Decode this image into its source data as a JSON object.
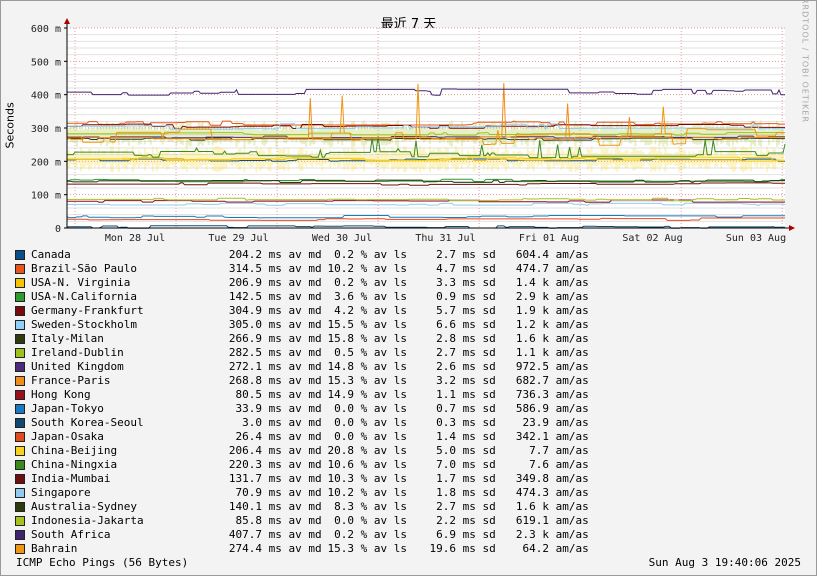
{
  "title": "最近 7 天",
  "watermark": "RRDTOOL / TOBI OETIKER",
  "footer": "ICMP Echo Pings (56 Bytes)",
  "timestamp": "Sun Aug  3 19:40:06 2025",
  "chart_data": {
    "type": "line",
    "ylabel": "Seconds",
    "ylim": [
      0,
      0.6
    ],
    "yticks": [
      {
        "v": 0,
        "label": "0"
      },
      {
        "v": 0.1,
        "label": "100 m"
      },
      {
        "v": 0.2,
        "label": "200 m"
      },
      {
        "v": 0.3,
        "label": "300 m"
      },
      {
        "v": 0.4,
        "label": "400 m"
      },
      {
        "v": 0.5,
        "label": "500 m"
      },
      {
        "v": 0.6,
        "label": "600 m"
      }
    ],
    "xticks": [
      "Mon 28 Jul",
      "Tue 29 Jul",
      "Wed 30 Jul",
      "Thu 31 Jul",
      "Fri 01 Aug",
      "Sat 02 Aug",
      "Sun 03 Aug"
    ],
    "grid": true,
    "legend_position": "bottom",
    "series": [
      {
        "name": "Canada",
        "color": "#0b4f8a",
        "avg": "204.2",
        "avg_unit": "ms av md",
        "loss": "0.2",
        "loss_unit": "% av ls",
        "sd": "2.7",
        "sd_unit": "ms sd",
        "am": "604.4",
        "am_unit": "am/as"
      },
      {
        "name": "Brazil-São Paulo",
        "color": "#e8541c",
        "avg": "314.5",
        "avg_unit": "ms av md",
        "loss": "10.2",
        "loss_unit": "% av ls",
        "sd": "4.7",
        "sd_unit": "ms sd",
        "am": "474.7",
        "am_unit": "am/as"
      },
      {
        "name": "USA-N. Virginia",
        "color": "#f4c400",
        "avg": "206.9",
        "avg_unit": "ms av md",
        "loss": "0.2",
        "loss_unit": "% av ls",
        "sd": "3.3",
        "sd_unit": "ms sd",
        "am": "1.4 k",
        "am_unit": "am/as"
      },
      {
        "name": "USA-N.California",
        "color": "#2f9a2f",
        "avg": "142.5",
        "avg_unit": "ms av md",
        "loss": "3.6",
        "loss_unit": "% av ls",
        "sd": "0.9",
        "sd_unit": "ms sd",
        "am": "2.9 k",
        "am_unit": "am/as"
      },
      {
        "name": "Germany-Frankfurt",
        "color": "#7a0a0a",
        "avg": "304.9",
        "avg_unit": "ms av md",
        "loss": "4.2",
        "loss_unit": "% av ls",
        "sd": "5.7",
        "sd_unit": "ms sd",
        "am": "1.9 k",
        "am_unit": "am/as"
      },
      {
        "name": "Sweden-Stockholm",
        "color": "#8fd0f5",
        "avg": "305.0",
        "avg_unit": "ms av md",
        "loss": "15.5",
        "loss_unit": "% av ls",
        "sd": "6.6",
        "sd_unit": "ms sd",
        "am": "1.2 k",
        "am_unit": "am/as"
      },
      {
        "name": "Italy-Milan",
        "color": "#2e3b10",
        "avg": "266.9",
        "avg_unit": "ms av md",
        "loss": "15.8",
        "loss_unit": "% av ls",
        "sd": "2.8",
        "sd_unit": "ms sd",
        "am": "1.6 k",
        "am_unit": "am/as"
      },
      {
        "name": "Ireland-Dublin",
        "color": "#9ec21c",
        "avg": "282.5",
        "avg_unit": "ms av md",
        "loss": "0.5",
        "loss_unit": "% av ls",
        "sd": "2.7",
        "sd_unit": "ms sd",
        "am": "1.1 k",
        "am_unit": "am/as"
      },
      {
        "name": "United Kingdom",
        "color": "#4b2a7a",
        "avg": "272.1",
        "avg_unit": "ms av md",
        "loss": "14.8",
        "loss_unit": "% av ls",
        "sd": "2.6",
        "sd_unit": "ms sd",
        "am": "972.5",
        "am_unit": "am/as"
      },
      {
        "name": "France-Paris",
        "color": "#f08c1a",
        "avg": "268.8",
        "avg_unit": "ms av md",
        "loss": "15.3",
        "loss_unit": "% av ls",
        "sd": "3.2",
        "sd_unit": "ms sd",
        "am": "682.7",
        "am_unit": "am/as"
      },
      {
        "name": "Hong Kong",
        "color": "#9a0f1e",
        "avg": "80.5",
        "avg_unit": "ms av md",
        "loss": "14.9",
        "loss_unit": "% av ls",
        "sd": "1.1",
        "sd_unit": "ms sd",
        "am": "736.3",
        "am_unit": "am/as"
      },
      {
        "name": "Japan-Tokyo",
        "color": "#1a7ac0",
        "avg": "33.9",
        "avg_unit": "ms av md",
        "loss": "0.0",
        "loss_unit": "% av ls",
        "sd": "0.7",
        "sd_unit": "ms sd",
        "am": "586.9",
        "am_unit": "am/as"
      },
      {
        "name": "South Korea-Seoul",
        "color": "#0e4a70",
        "avg": "3.0",
        "avg_unit": "ms av md",
        "loss": "0.0",
        "loss_unit": "% av ls",
        "sd": "0.3",
        "sd_unit": "ms sd",
        "am": "23.9",
        "am_unit": "am/as"
      },
      {
        "name": "Japan-Osaka",
        "color": "#e24a1c",
        "avg": "26.4",
        "avg_unit": "ms av md",
        "loss": "0.0",
        "loss_unit": "% av ls",
        "sd": "1.4",
        "sd_unit": "ms sd",
        "am": "342.1",
        "am_unit": "am/as"
      },
      {
        "name": "China-Beijing",
        "color": "#f6d21a",
        "avg": "206.4",
        "avg_unit": "ms av md",
        "loss": "20.8",
        "loss_unit": "% av ls",
        "sd": "5.0",
        "sd_unit": "ms sd",
        "am": "7.7",
        "am_unit": "am/as"
      },
      {
        "name": "China-Ningxia",
        "color": "#3a8a1e",
        "avg": "220.3",
        "avg_unit": "ms av md",
        "loss": "10.6",
        "loss_unit": "% av ls",
        "sd": "7.0",
        "sd_unit": "ms sd",
        "am": "7.6",
        "am_unit": "am/as"
      },
      {
        "name": "India-Mumbai",
        "color": "#6e0e0e",
        "avg": "131.7",
        "avg_unit": "ms av md",
        "loss": "10.3",
        "loss_unit": "% av ls",
        "sd": "1.7",
        "sd_unit": "ms sd",
        "am": "349.8",
        "am_unit": "am/as"
      },
      {
        "name": "Singapore",
        "color": "#90ccf0",
        "avg": "70.9",
        "avg_unit": "ms av md",
        "loss": "10.2",
        "loss_unit": "% av ls",
        "sd": "1.8",
        "sd_unit": "ms sd",
        "am": "474.3",
        "am_unit": "am/as"
      },
      {
        "name": "Australia-Sydney",
        "color": "#2d3a0e",
        "avg": "140.1",
        "avg_unit": "ms av md",
        "loss": "8.3",
        "loss_unit": "% av ls",
        "sd": "2.7",
        "sd_unit": "ms sd",
        "am": "1.6 k",
        "am_unit": "am/as"
      },
      {
        "name": "Indonesia-Jakarta",
        "color": "#a6c21c",
        "avg": "85.8",
        "avg_unit": "ms av md",
        "loss": "0.0",
        "loss_unit": "% av ls",
        "sd": "2.2",
        "sd_unit": "ms sd",
        "am": "619.1",
        "am_unit": "am/as"
      },
      {
        "name": "South Africa",
        "color": "#3f2370",
        "avg": "407.7",
        "avg_unit": "ms av md",
        "loss": "0.2",
        "loss_unit": "% av ls",
        "sd": "6.9",
        "sd_unit": "ms sd",
        "am": "2.3 k",
        "am_unit": "am/as"
      },
      {
        "name": "Bahrain",
        "color": "#f0960e",
        "avg": "274.4",
        "avg_unit": "ms av md",
        "loss": "15.3",
        "loss_unit": "% av ls",
        "sd": "19.6",
        "sd_unit": "ms sd",
        "am": "64.2",
        "am_unit": "am/as"
      }
    ]
  }
}
